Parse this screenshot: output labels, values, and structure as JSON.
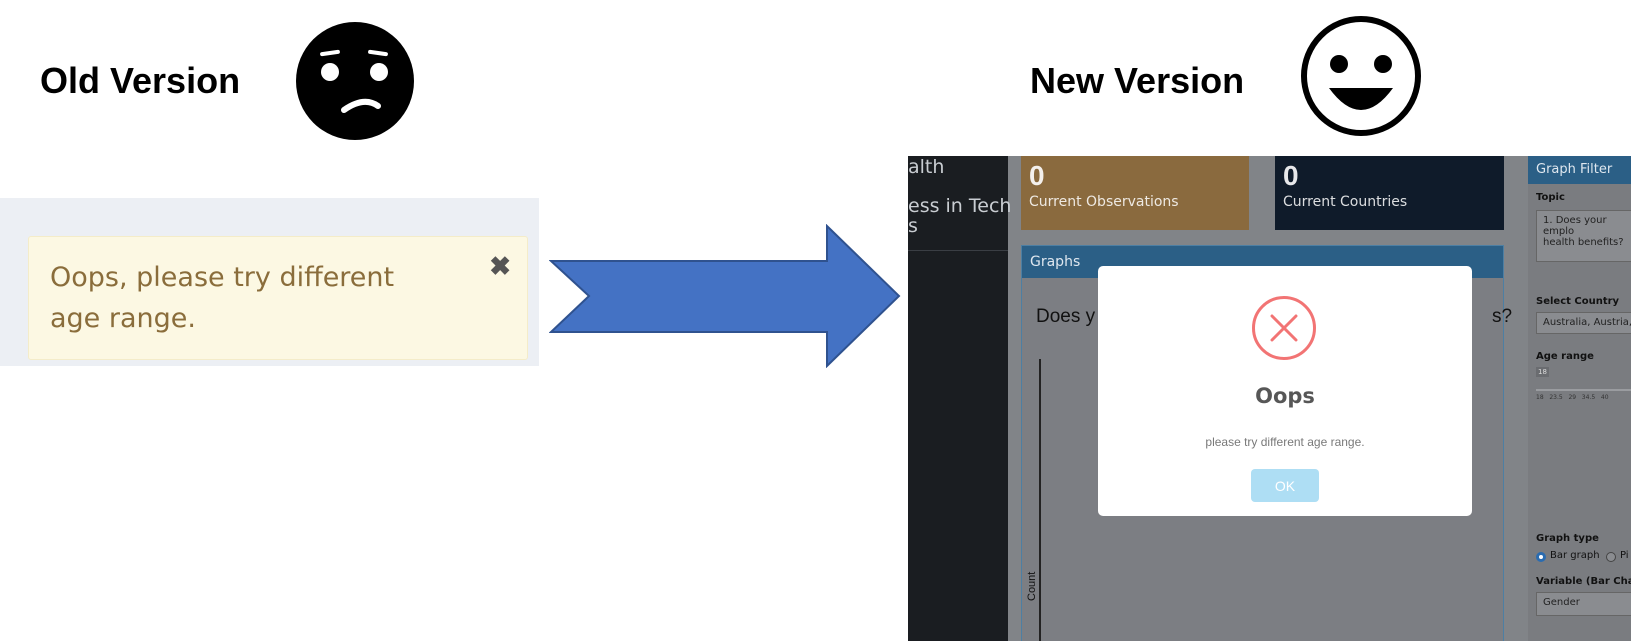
{
  "old": {
    "heading": "Old Version",
    "alert_text": "Oops, please try different age range.",
    "close_glyph": "✖"
  },
  "new": {
    "heading": "New Version",
    "sidebar": {
      "items": [
        "alth",
        "ess in Tech",
        "s"
      ]
    },
    "value_boxes": [
      {
        "value": "0",
        "label": "Current Observations",
        "color": "#8a6a3e"
      },
      {
        "value": "0",
        "label": "Current Countries",
        "color": "#0f1b2a"
      }
    ],
    "graphs": {
      "header": "Graphs",
      "question_start": "Does y",
      "question_end": "s?",
      "y_axis_label": "Count"
    },
    "filter": {
      "header": "Graph Filter",
      "topic_label": "Topic",
      "topic_value_line1": "1. Does your emplo",
      "topic_value_line2": "health benefits?",
      "country_label": "Select Country",
      "country_value": "Australia, Austria, ",
      "age_label": "Age range",
      "age_min": "18",
      "age_ticks": "18   23.5   29   34.5   40",
      "graph_type_label": "Graph type",
      "graph_type_options": [
        "Bar graph",
        "Pi"
      ],
      "variable_label": "Variable (Bar Chart",
      "variable_value": "Gender"
    },
    "modal": {
      "title": "Oops",
      "text": "please try different age range.",
      "ok_label": "OK"
    }
  },
  "colors": {
    "arrow": "#4472c4",
    "error_red": "#f27474",
    "ok_button": "#aedef4",
    "header_blue": "#2b5f86"
  },
  "icons": [
    "confused-face-icon",
    "smiley-face-icon",
    "close-icon",
    "right-arrow-icon",
    "error-x-icon"
  ]
}
